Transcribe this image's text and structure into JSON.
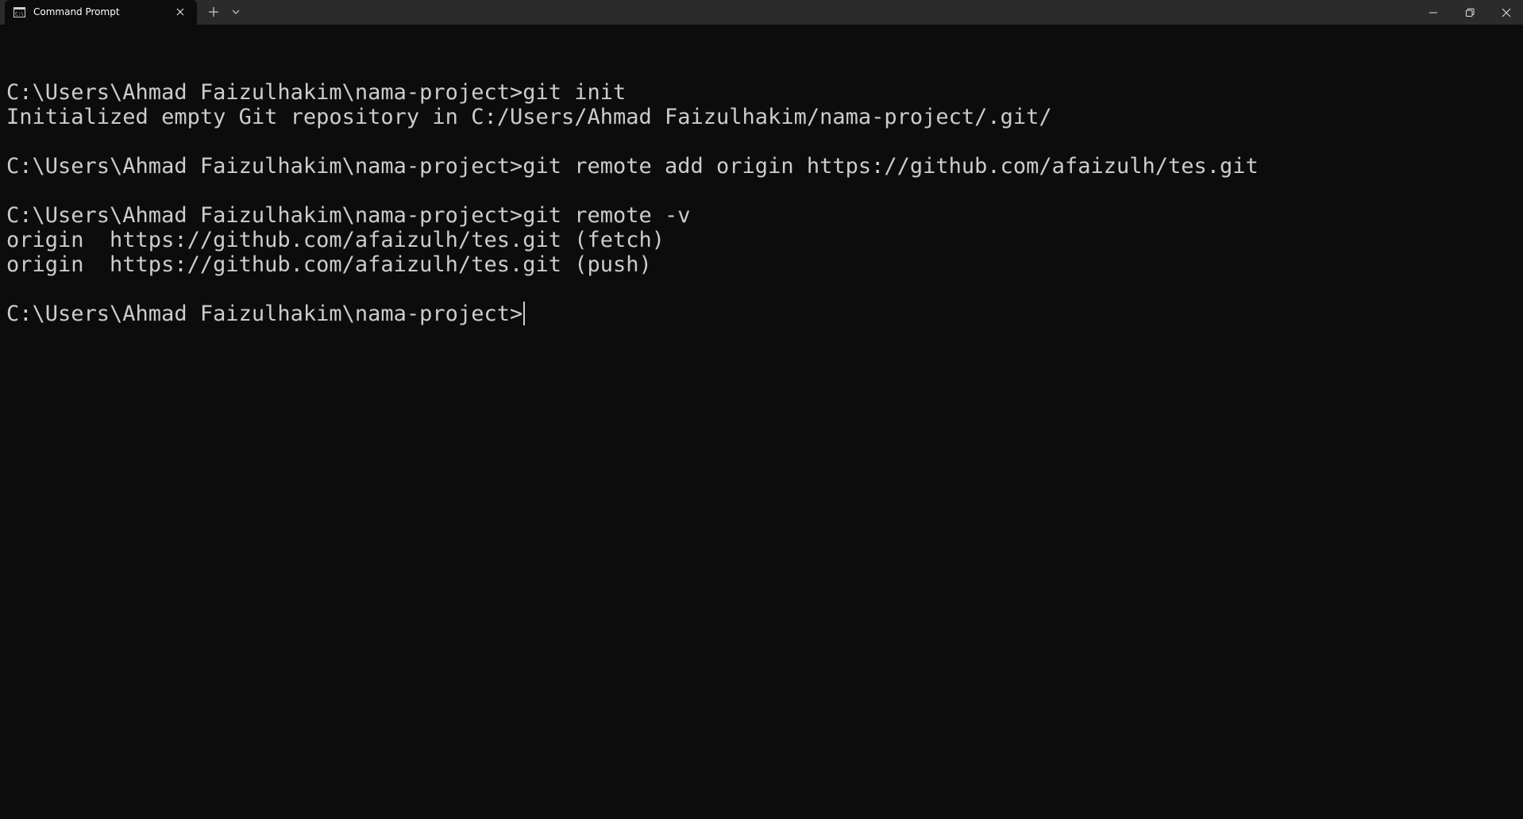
{
  "window": {
    "tab_title": "Command Prompt",
    "icons": {
      "tab": "cmd-icon",
      "close_tab": "close-icon",
      "new_tab": "plus-icon",
      "dropdown": "chevron-down-icon",
      "minimize": "minimize-icon",
      "maximize": "restore-icon",
      "close_window": "close-icon"
    }
  },
  "terminal": {
    "lines": [
      "",
      "C:\\Users\\Ahmad Faizulhakim\\nama-project>git init",
      "Initialized empty Git repository in C:/Users/Ahmad Faizulhakim/nama-project/.git/",
      "",
      "C:\\Users\\Ahmad Faizulhakim\\nama-project>git remote add origin https://github.com/afaizulh/tes.git",
      "",
      "C:\\Users\\Ahmad Faizulhakim\\nama-project>git remote -v",
      "origin  https://github.com/afaizulh/tes.git (fetch)",
      "origin  https://github.com/afaizulh/tes.git (push)",
      "",
      "C:\\Users\\Ahmad Faizulhakim\\nama-project>"
    ]
  },
  "colors": {
    "background": "#0c0c0c",
    "titlebar": "#2b2b2b",
    "text": "#cccccc"
  }
}
